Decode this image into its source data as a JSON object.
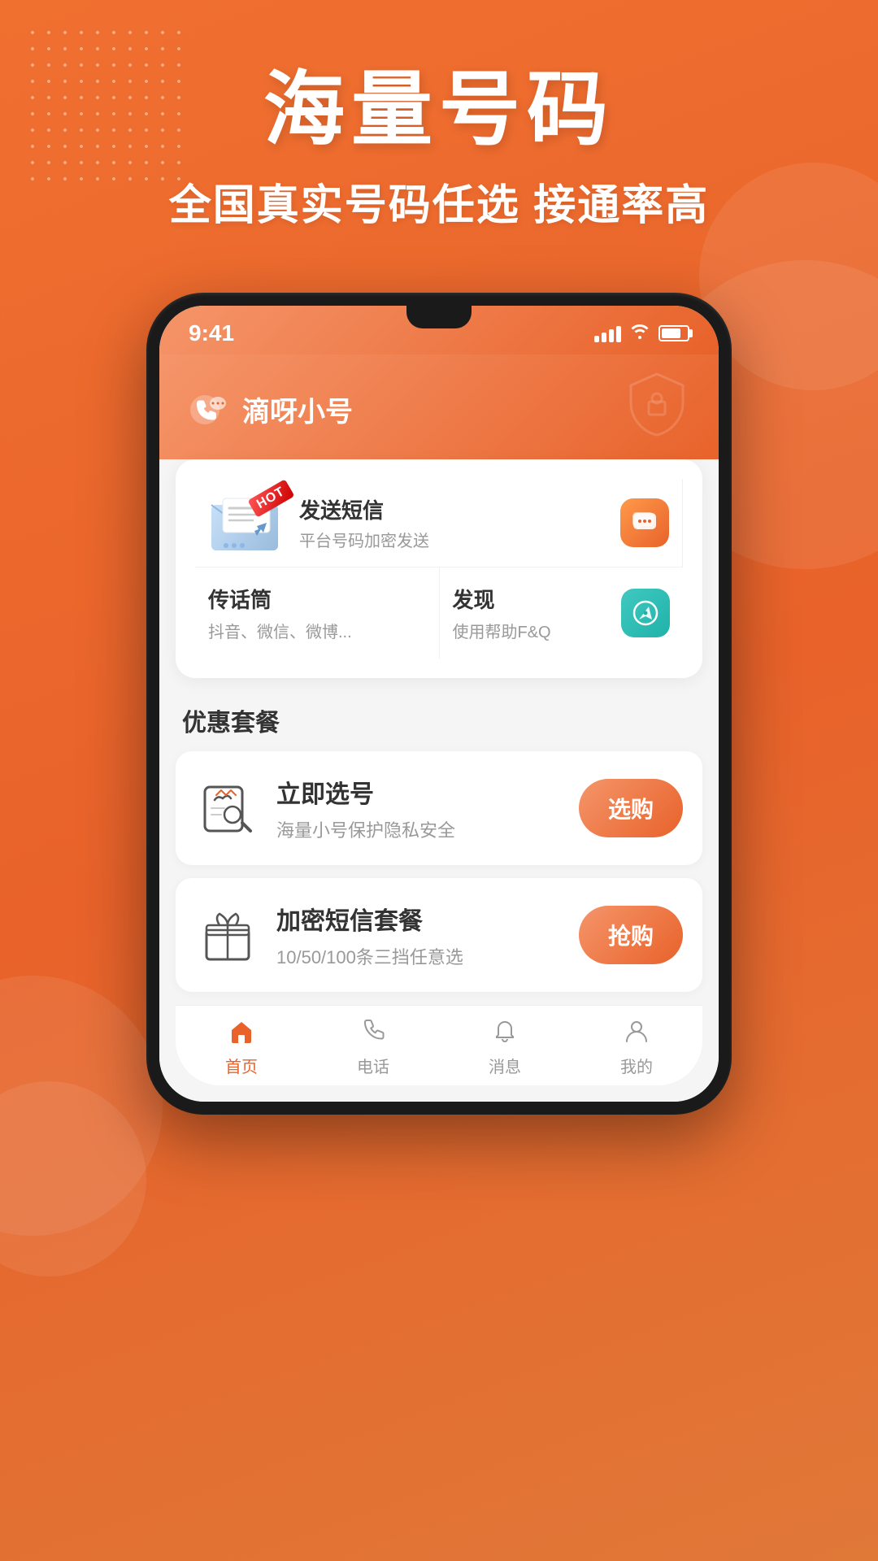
{
  "page": {
    "background_gradient": [
      "#f07030",
      "#e8622a",
      "#e07838"
    ]
  },
  "header": {
    "main_title": "海量号码",
    "sub_title": "全国真实号码任选 接通率高"
  },
  "phone_mockup": {
    "status_bar": {
      "time": "9:41"
    },
    "app_name": "滴呀小号",
    "features": {
      "sms": {
        "hot_badge": "HOT",
        "title": "发送短信",
        "desc": "平台号码加密发送"
      },
      "chuanhuatong": {
        "title": "传话筒",
        "desc": "抖音、微信、微博..."
      },
      "discover": {
        "title": "发现",
        "desc": "使用帮助F&Q"
      }
    },
    "section_title": "优惠套餐",
    "packages": [
      {
        "name": "立即选号",
        "desc": "海量小号保护隐私安全",
        "btn_label": "选购"
      },
      {
        "name": "加密短信套餐",
        "desc": "10/50/100条三挡任意选",
        "btn_label": "抢购"
      }
    ],
    "bottom_nav": [
      {
        "label": "首页",
        "active": true
      },
      {
        "label": "电话",
        "active": false
      },
      {
        "label": "消息",
        "active": false
      },
      {
        "label": "我的",
        "active": false
      }
    ]
  }
}
